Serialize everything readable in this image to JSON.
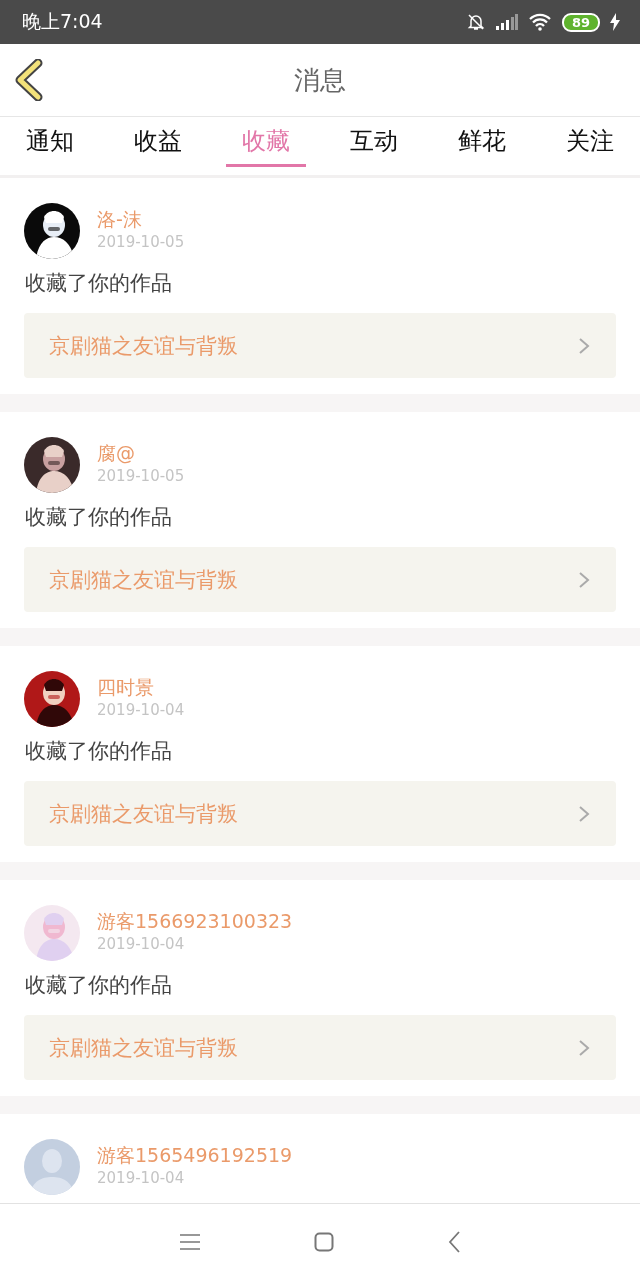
{
  "status_bar": {
    "time": "晚上7:04",
    "battery": "89"
  },
  "header": {
    "title": "消息"
  },
  "tabs": [
    {
      "label": "通知",
      "selected": false
    },
    {
      "label": "收益",
      "selected": false
    },
    {
      "label": "收藏",
      "selected": true
    },
    {
      "label": "互动",
      "selected": false
    },
    {
      "label": "鲜花",
      "selected": false
    },
    {
      "label": "关注",
      "selected": false
    }
  ],
  "messages": [
    {
      "name": "洛-沫",
      "date": "2019-10-05",
      "text": "收藏了你的作品",
      "work": "京剧猫之友谊与背叛"
    },
    {
      "name": "腐@",
      "date": "2019-10-05",
      "text": "收藏了你的作品",
      "work": "京剧猫之友谊与背叛"
    },
    {
      "name": "四时景",
      "date": "2019-10-04",
      "text": "收藏了你的作品",
      "work": "京剧猫之友谊与背叛"
    },
    {
      "name": "游客1566923100323",
      "date": "2019-10-04",
      "text": "收藏了你的作品",
      "work": "京剧猫之友谊与背叛"
    },
    {
      "avatar": {
        "kind": "default"
      },
      "name": "游客1565496192519",
      "date": "2019-10-04"
    }
  ]
}
